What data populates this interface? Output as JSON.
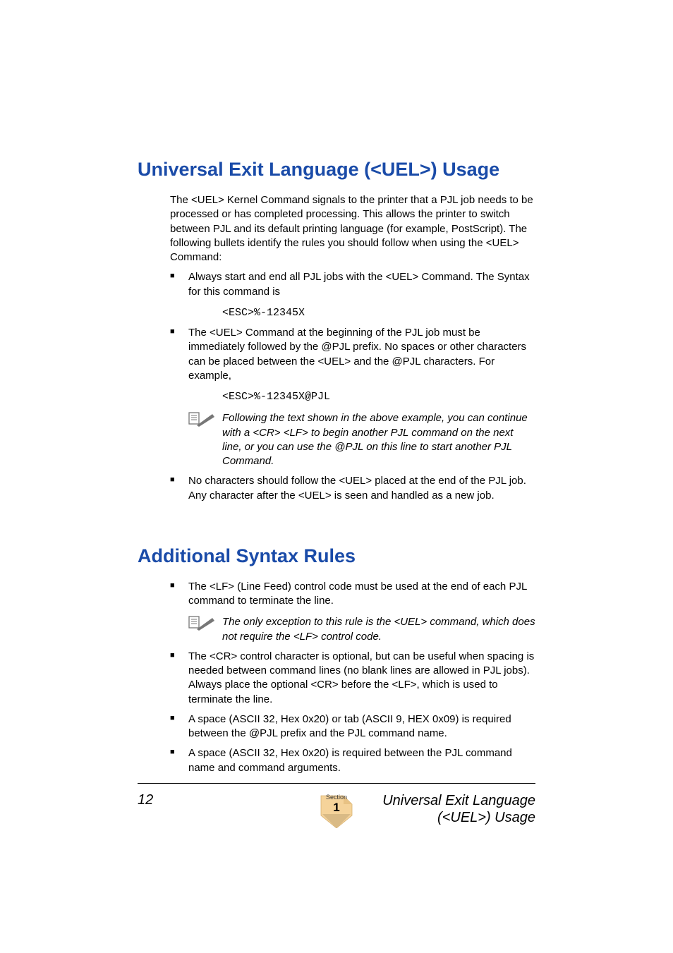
{
  "section1": {
    "heading": "Universal Exit Language (<UEL>) Usage",
    "intro": "The <UEL> Kernel Command signals to the printer that a PJL job needs to be processed or has completed processing. This allows the printer to switch between PJL and its default printing language (for example, PostScript). The following bullets identify the rules you should follow when using the <UEL> Command:",
    "bullets": {
      "b1": "Always start and end all PJL jobs with the <UEL> Command. The Syntax for this command is",
      "code1": "<ESC>%-12345X",
      "b2": "The <UEL> Command at the beginning of the PJL job must be immediately followed by the @PJL prefix. No spaces or other characters can be placed between the <UEL> and the @PJL characters. For example,",
      "code2": "<ESC>%-12345X@PJL",
      "note2": "Following the text shown in the above example, you can continue with a <CR> <LF> to begin another PJL command on the next line, or you can use the @PJL on this line to start another PJL Command.",
      "b3": "No characters should follow the <UEL> placed at the end of the PJL job. Any character after the <UEL> is seen and handled as a new job."
    }
  },
  "section2": {
    "heading": "Additional Syntax Rules",
    "bullets": {
      "b1": "The <LF> (Line Feed) control code must be used at the end of each PJL command to terminate the line.",
      "note1": "The only exception to this rule is the <UEL> command, which does not require the <LF> control code.",
      "b2": "The <CR> control character is optional, but can be useful when spacing is needed between command lines (no blank lines are allowed in PJL jobs). Always place the optional <CR> before the <LF>, which is used to terminate the line.",
      "b3": "A space (ASCII 32, Hex 0x20) or tab (ASCII 9, HEX 0x09) is required between the @PJL prefix and the PJL command name.",
      "b4": "A space (ASCII 32, Hex 0x20) is required between the PJL command name and command arguments."
    }
  },
  "footer": {
    "page_number": "12",
    "section_label": "Section",
    "section_number": "1",
    "right_line1": "Universal Exit Language",
    "right_line2": "(<UEL>) Usage"
  }
}
